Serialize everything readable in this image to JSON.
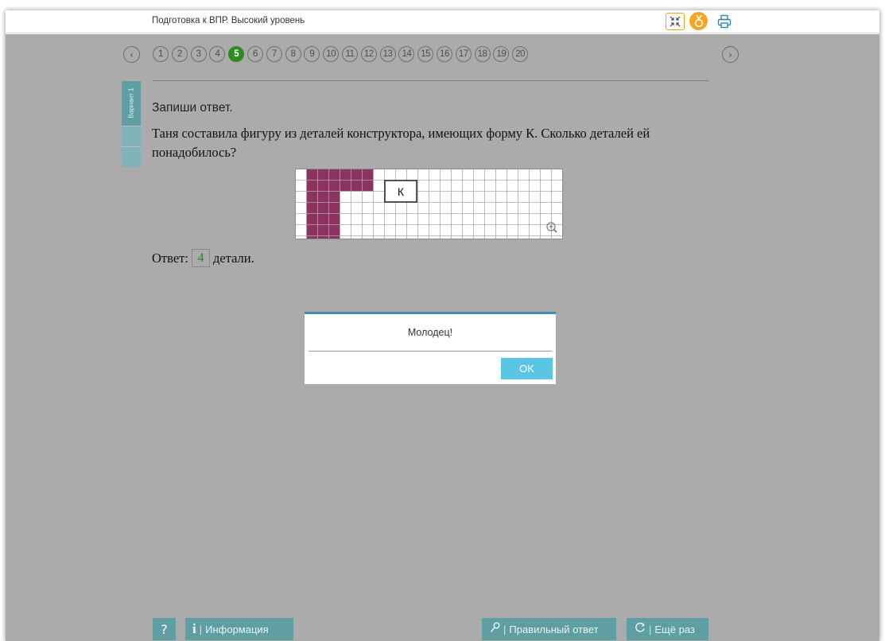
{
  "header": {
    "title": "Подготовка к ВПР. Высокий уровень",
    "icons": [
      "collapse-icon",
      "medal-icon",
      "print-icon"
    ],
    "accent_color": "#f5a623"
  },
  "pagination": {
    "pages": [
      "1",
      "2",
      "3",
      "4",
      "5",
      "6",
      "7",
      "8",
      "9",
      "10",
      "11",
      "12",
      "13",
      "14",
      "15",
      "16",
      "17",
      "18",
      "19",
      "20"
    ],
    "active": "5",
    "prev_icon": "chevron-left-icon",
    "next_icon": "chevron-right-icon",
    "active_color": "#2e8b20"
  },
  "variant": {
    "label": "Вариант 1"
  },
  "task": {
    "instruction": "Запиши ответ.",
    "question": "Таня составила фигуру из деталей конструктора, имеющих форму К. Сколько деталей ей понадобилось?",
    "piece_label": "К",
    "zoom_icon": "zoom-in-icon",
    "shape_color": "#8b3461"
  },
  "answer": {
    "prefix": "Ответ:",
    "value": "4",
    "suffix": "детали."
  },
  "dialog": {
    "message": "Молодец!",
    "ok_label": "OK"
  },
  "toolbar": {
    "help_label": "?",
    "info_label": "Информация",
    "correct_label": "Правильный ответ",
    "again_label": "Ещё раз",
    "button_color": "#5f9fa4"
  }
}
